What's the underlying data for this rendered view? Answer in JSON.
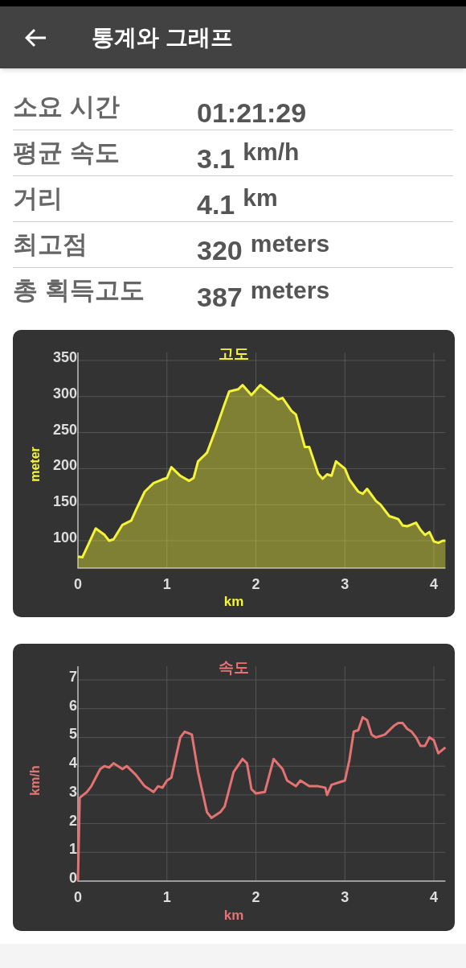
{
  "header": {
    "title": "통계와 그래프"
  },
  "stats": [
    {
      "label": "소요 시간",
      "value": "01:21:29"
    },
    {
      "label": "평균 속도",
      "value": "3.1",
      "unit": "km/h"
    },
    {
      "label": "거리",
      "value": "4.1",
      "unit": "km"
    },
    {
      "label": "최고점",
      "value": "320",
      "unit": "meters"
    },
    {
      "label": "총 획득고도",
      "value": "387",
      "unit": "meters"
    }
  ],
  "charts": [
    {
      "chart_data": {
        "type": "area",
        "grid": true,
        "title": "고도",
        "xlabel": "km",
        "ylabel": "meter",
        "xlim": [
          0,
          4.13
        ],
        "ylim": [
          62,
          350
        ],
        "xticks": [
          0,
          1,
          2,
          3,
          4
        ],
        "yticks": [
          100,
          150,
          200,
          250,
          300,
          350
        ],
        "x": [
          0,
          0.05,
          0.2,
          0.3,
          0.35,
          0.4,
          0.5,
          0.6,
          0.65,
          0.75,
          0.85,
          0.95,
          1.0,
          1.05,
          1.15,
          1.25,
          1.3,
          1.35,
          1.45,
          1.55,
          1.65,
          1.7,
          1.8,
          1.85,
          1.95,
          2.05,
          2.15,
          2.25,
          2.3,
          2.4,
          2.45,
          2.55,
          2.6,
          2.7,
          2.75,
          2.8,
          2.85,
          2.9,
          3.0,
          3.05,
          3.15,
          3.2,
          3.25,
          3.35,
          3.4,
          3.5,
          3.55,
          3.6,
          3.65,
          3.7,
          3.8,
          3.85,
          3.9,
          3.95,
          4.0,
          4.05,
          4.1,
          4.13
        ],
        "series": [
          {
            "color": "#f4f43a",
            "values": [
              78,
              77,
              117,
              108,
              100,
              102,
              122,
              128,
              142,
              168,
              180,
              185,
              187,
              202,
              190,
              183,
              187,
              210,
              222,
              255,
              290,
              307,
              310,
              316,
              302,
              316,
              306,
              296,
              298,
              280,
              275,
              230,
              230,
              193,
              186,
              192,
              190,
              210,
              200,
              185,
              168,
              165,
              172,
              155,
              150,
              134,
              132,
              130,
              121,
              120,
              125,
              115,
              108,
              112,
              99,
              97,
              100,
              100
            ]
          }
        ]
      }
    },
    {
      "chart_data": {
        "type": "line",
        "grid": true,
        "title": "속도",
        "xlabel": "km",
        "ylabel": "km/h",
        "xlim": [
          0,
          4.13
        ],
        "ylim": [
          0,
          7
        ],
        "xticks": [
          0,
          1,
          2,
          3,
          4
        ],
        "yticks": [
          0,
          1,
          2,
          3,
          4,
          5,
          6,
          7
        ],
        "x": [
          0,
          0.02,
          0.1,
          0.15,
          0.25,
          0.3,
          0.35,
          0.4,
          0.5,
          0.55,
          0.65,
          0.75,
          0.85,
          0.9,
          0.95,
          1.0,
          1.05,
          1.15,
          1.2,
          1.28,
          1.35,
          1.45,
          1.5,
          1.6,
          1.65,
          1.75,
          1.85,
          1.9,
          1.95,
          2.0,
          2.1,
          2.2,
          2.3,
          2.35,
          2.45,
          2.5,
          2.6,
          2.7,
          2.78,
          2.8,
          2.85,
          2.95,
          3.0,
          3.05,
          3.1,
          3.15,
          3.2,
          3.25,
          3.3,
          3.35,
          3.45,
          3.55,
          3.6,
          3.65,
          3.7,
          3.75,
          3.8,
          3.85,
          3.9,
          3.95,
          4.0,
          4.05,
          4.13
        ],
        "series": [
          {
            "color": "#e57373",
            "values": [
              0,
              2.9,
              3.1,
              3.3,
              3.9,
              4.0,
              3.95,
              4.1,
              3.9,
              4.0,
              3.7,
              3.3,
              3.1,
              3.3,
              3.25,
              3.5,
              3.6,
              5.0,
              5.2,
              5.1,
              3.8,
              2.4,
              2.2,
              2.4,
              2.6,
              3.8,
              4.25,
              4.1,
              3.2,
              3.05,
              3.1,
              4.25,
              3.9,
              3.5,
              3.3,
              3.5,
              3.3,
              3.3,
              3.25,
              3.0,
              3.35,
              3.45,
              3.5,
              4.2,
              5.2,
              5.25,
              5.7,
              5.6,
              5.1,
              5.0,
              5.1,
              5.4,
              5.5,
              5.5,
              5.3,
              5.2,
              5.0,
              4.7,
              4.7,
              5.0,
              4.9,
              4.45,
              4.65
            ]
          }
        ]
      }
    }
  ]
}
